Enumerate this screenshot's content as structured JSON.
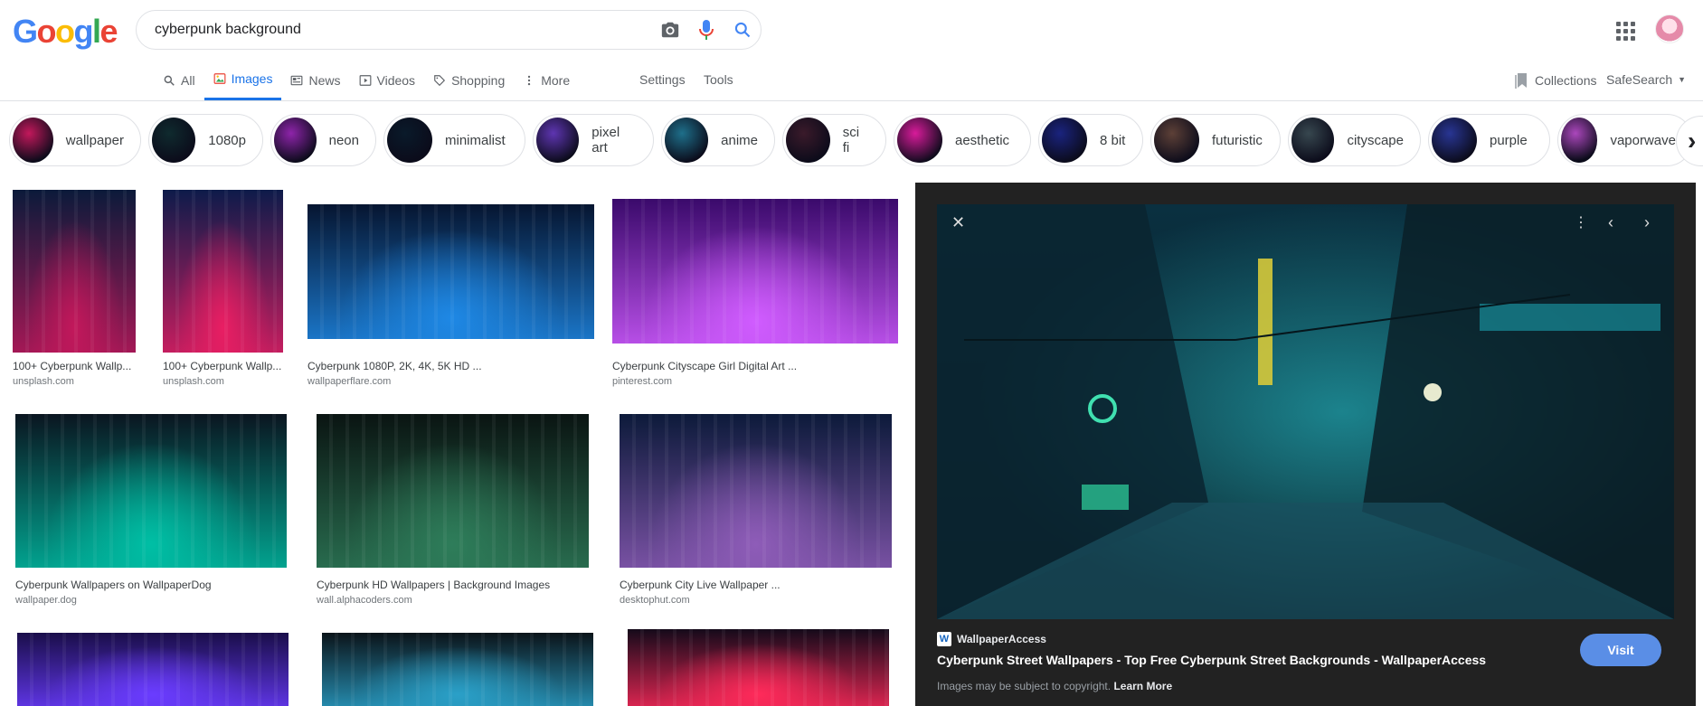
{
  "logo": [
    "G",
    "o",
    "o",
    "g",
    "l",
    "e"
  ],
  "logo_colors": [
    "#4285f4",
    "#ea4335",
    "#fbbc05",
    "#4285f4",
    "#34a853",
    "#ea4335"
  ],
  "search": {
    "query": "cyberpunk background"
  },
  "tabs": [
    {
      "label": "All",
      "icon": "search-icon"
    },
    {
      "label": "Images",
      "icon": "image-icon",
      "active": true
    },
    {
      "label": "News",
      "icon": "news-icon"
    },
    {
      "label": "Videos",
      "icon": "video-icon"
    },
    {
      "label": "Shopping",
      "icon": "tag-icon"
    },
    {
      "label": "More",
      "icon": "more-vert-icon"
    }
  ],
  "tools": {
    "settings": "Settings",
    "tools": "Tools"
  },
  "rightnav": {
    "collections": "Collections",
    "safesearch": "SafeSearch"
  },
  "chips": [
    {
      "label": "wallpaper",
      "color": "#c2185b"
    },
    {
      "label": "1080p",
      "color": "#0f2a2e"
    },
    {
      "label": "neon",
      "color": "#8e24aa"
    },
    {
      "label": "minimalist",
      "color": "#0a1a2a"
    },
    {
      "label": "pixel art",
      "color": "#5e35b1"
    },
    {
      "label": "anime",
      "color": "#1e6f8a"
    },
    {
      "label": "sci fi",
      "color": "#3a1a2a"
    },
    {
      "label": "aesthetic",
      "color": "#d81b9a"
    },
    {
      "label": "8 bit",
      "color": "#1a237e"
    },
    {
      "label": "futuristic",
      "color": "#5d4037"
    },
    {
      "label": "cityscape",
      "color": "#37474f"
    },
    {
      "label": "purple",
      "color": "#283593"
    },
    {
      "label": "vaporwave",
      "color": "#ab47bc"
    }
  ],
  "results": [
    {
      "title": "100+ Cyberpunk Wallp...",
      "source": "unsplash.com",
      "c1": "#0b1a3a",
      "c2": "#c2185b"
    },
    {
      "title": "100+ Cyberpunk Wallp...",
      "source": "unsplash.com",
      "c1": "#0d1b4a",
      "c2": "#e91e63"
    },
    {
      "title": "Cyberpunk 1080P, 2K, 4K, 5K HD ...",
      "source": "wallpaperflare.com",
      "c1": "#061530",
      "c2": "#1e88e5"
    },
    {
      "title": "Cyberpunk Cityscape Girl Digital Art ...",
      "source": "pinterest.com",
      "c1": "#3a0a6b",
      "c2": "#d05cff"
    },
    {
      "title": "Cyberpunk Wallpapers on WallpaperDog",
      "source": "wallpaper.dog",
      "c1": "#0a1520",
      "c2": "#00bfa5"
    },
    {
      "title": "Cyberpunk HD Wallpapers | Background Images",
      "source": "wall.alphacoders.com",
      "c1": "#0a1412",
      "c2": "#2e7d5a"
    },
    {
      "title": "Cyberpunk City Live Wallpaper ...",
      "source": "desktophut.com",
      "c1": "#0c1a3a",
      "c2": "#8e5cb8"
    },
    {
      "title": "",
      "source": "",
      "c1": "#1a0e4a",
      "c2": "#6a3cff"
    },
    {
      "title": "",
      "source": "",
      "c1": "#0b141a",
      "c2": "#2aa0c8"
    },
    {
      "title": "",
      "source": "",
      "c1": "#150a1a",
      "c2": "#ff2a5a"
    }
  ],
  "preview": {
    "site": "WallpaperAccess",
    "site_badge": "W",
    "title": "Cyberpunk Street Wallpapers - Top Free Cyberpunk Street Backgrounds - WallpaperAccess",
    "copyright": "Images may be subject to copyright.",
    "learn_more": "Learn More",
    "visit": "Visit",
    "img_c1": "#0a3040",
    "img_c2": "#2ad0d8"
  }
}
